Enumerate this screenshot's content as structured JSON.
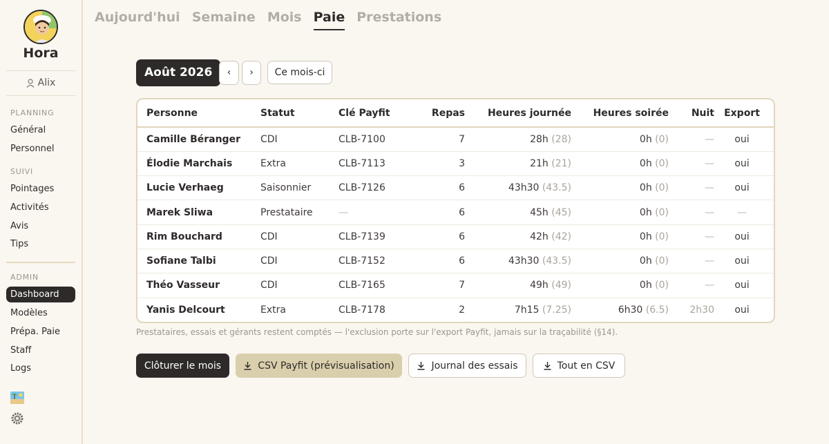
{
  "app": {
    "name": "Hora",
    "user": "Alix"
  },
  "sidebar": {
    "sections": [
      {
        "label": "PLANNING",
        "items": [
          "Général",
          "Personnel"
        ]
      },
      {
        "label": "SUIVI",
        "items": [
          "Pointages",
          "Activités",
          "Avis",
          "Tips"
        ]
      },
      {
        "label": "ADMIN",
        "items": [
          "Dashboard",
          "Modèles",
          "Prépa. Paie",
          "Staff",
          "Logs"
        ]
      }
    ],
    "active_item": "Dashboard",
    "bottom_icons": [
      "beach-icon",
      "settings-gear-icon"
    ]
  },
  "tabs": [
    "Aujourd'hui",
    "Semaine",
    "Mois",
    "Paie",
    "Prestations"
  ],
  "active_tab": "Paie",
  "period": {
    "label": "Août 2026",
    "prev": "‹",
    "next": "›",
    "today": "Ce mois-ci"
  },
  "table": {
    "headers": [
      "Personne",
      "Statut",
      "Clé Payfit",
      "Repas",
      "Heures journée",
      "Heures soirée",
      "Nuit",
      "Export"
    ],
    "rows": [
      {
        "name": "Camille Béranger",
        "statut": "CDI",
        "cle": "CLB-7100",
        "repas": "7",
        "jour": "28h",
        "jour_dec": "(28)",
        "soir": "0h",
        "soir_dec": "(0)",
        "nuit": "—",
        "export": "oui"
      },
      {
        "name": "Élodie Marchais",
        "statut": "Extra",
        "cle": "CLB-7113",
        "repas": "3",
        "jour": "21h",
        "jour_dec": "(21)",
        "soir": "0h",
        "soir_dec": "(0)",
        "nuit": "—",
        "export": "oui"
      },
      {
        "name": "Lucie Verhaeg",
        "statut": "Saisonnier",
        "cle": "CLB-7126",
        "repas": "6",
        "jour": "43h30",
        "jour_dec": "(43.5)",
        "soir": "0h",
        "soir_dec": "(0)",
        "nuit": "—",
        "export": "oui"
      },
      {
        "name": "Marek Sliwa",
        "statut": "Prestataire",
        "cle": "—",
        "repas": "6",
        "jour": "45h",
        "jour_dec": "(45)",
        "soir": "0h",
        "soir_dec": "(0)",
        "nuit": "—",
        "export": "—"
      },
      {
        "name": "Rim Bouchard",
        "statut": "CDI",
        "cle": "CLB-7139",
        "repas": "6",
        "jour": "42h",
        "jour_dec": "(42)",
        "soir": "0h",
        "soir_dec": "(0)",
        "nuit": "—",
        "export": "oui"
      },
      {
        "name": "Sofiane Talbi",
        "statut": "CDI",
        "cle": "CLB-7152",
        "repas": "6",
        "jour": "43h30",
        "jour_dec": "(43.5)",
        "soir": "0h",
        "soir_dec": "(0)",
        "nuit": "—",
        "export": "oui"
      },
      {
        "name": "Théo Vasseur",
        "statut": "CDI",
        "cle": "CLB-7165",
        "repas": "7",
        "jour": "49h",
        "jour_dec": "(49)",
        "soir": "0h",
        "soir_dec": "(0)",
        "nuit": "—",
        "export": "oui"
      },
      {
        "name": "Yanis Delcourt",
        "statut": "Extra",
        "cle": "CLB-7178",
        "repas": "2",
        "jour": "7h15",
        "jour_dec": "(7.25)",
        "soir": "6h30",
        "soir_dec": "(6.5)",
        "nuit": "2h30",
        "export": "oui"
      }
    ]
  },
  "footnote": "Prestataires, essais et gérants restent comptés — l'exclusion porte sur l'export Payfit, jamais sur la traçabilité (§14).",
  "actions": {
    "close_month": "Clôturer le mois",
    "csv_payfit": "CSV Payfit (prévisualisation)",
    "journal": "Journal des essais",
    "all_csv": "Tout en CSV"
  }
}
